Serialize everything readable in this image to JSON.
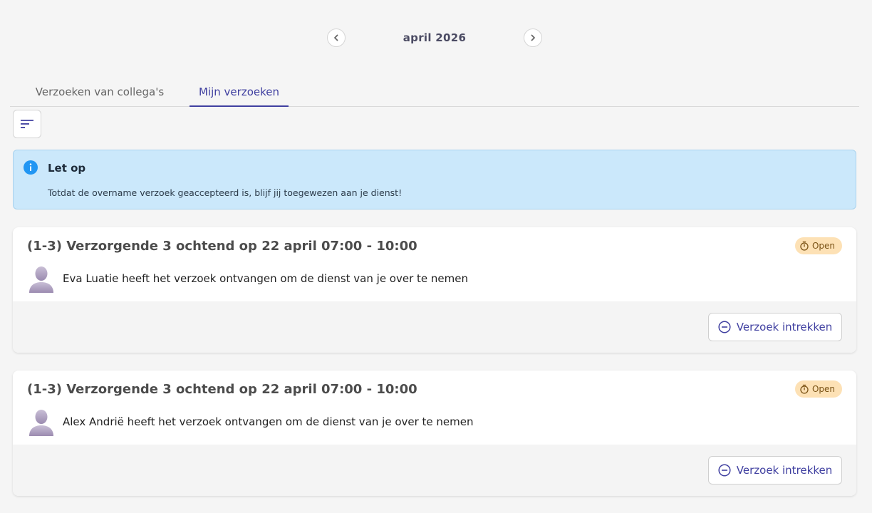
{
  "month_nav": {
    "label": "april 2026",
    "prev_icon": "chevron-left-icon",
    "next_icon": "chevron-right-icon"
  },
  "tabs": [
    {
      "label": "Verzoeken van collega's",
      "active": false
    },
    {
      "label": "Mijn verzoeken",
      "active": true
    }
  ],
  "sort_icon": "sort-icon",
  "alert": {
    "title": "Let op",
    "text": "Totdat de overname verzoek geaccepteerd is, blijf jij toegewezen aan je dienst!"
  },
  "requests": [
    {
      "title": "(1-3) Verzorgende 3 ochtend op 22 april 07:00 - 10:00",
      "status": "Open",
      "message": "Eva Luatie heeft het verzoek ontvangen om de dienst van je over te nemen",
      "button_label": "Verzoek intrekken"
    },
    {
      "title": "(1-3) Verzorgende 3 ochtend op 22 april 07:00 - 10:00",
      "status": "Open",
      "message": "Alex Andrië heeft het verzoek ontvangen om de dienst van je over te nemen",
      "button_label": "Verzoek intrekken"
    }
  ],
  "colors": {
    "accent": "#3f3fa0",
    "alert_bg": "#cbe8fb",
    "badge_bg": "#fde1b5",
    "info_icon": "#2196f3"
  }
}
